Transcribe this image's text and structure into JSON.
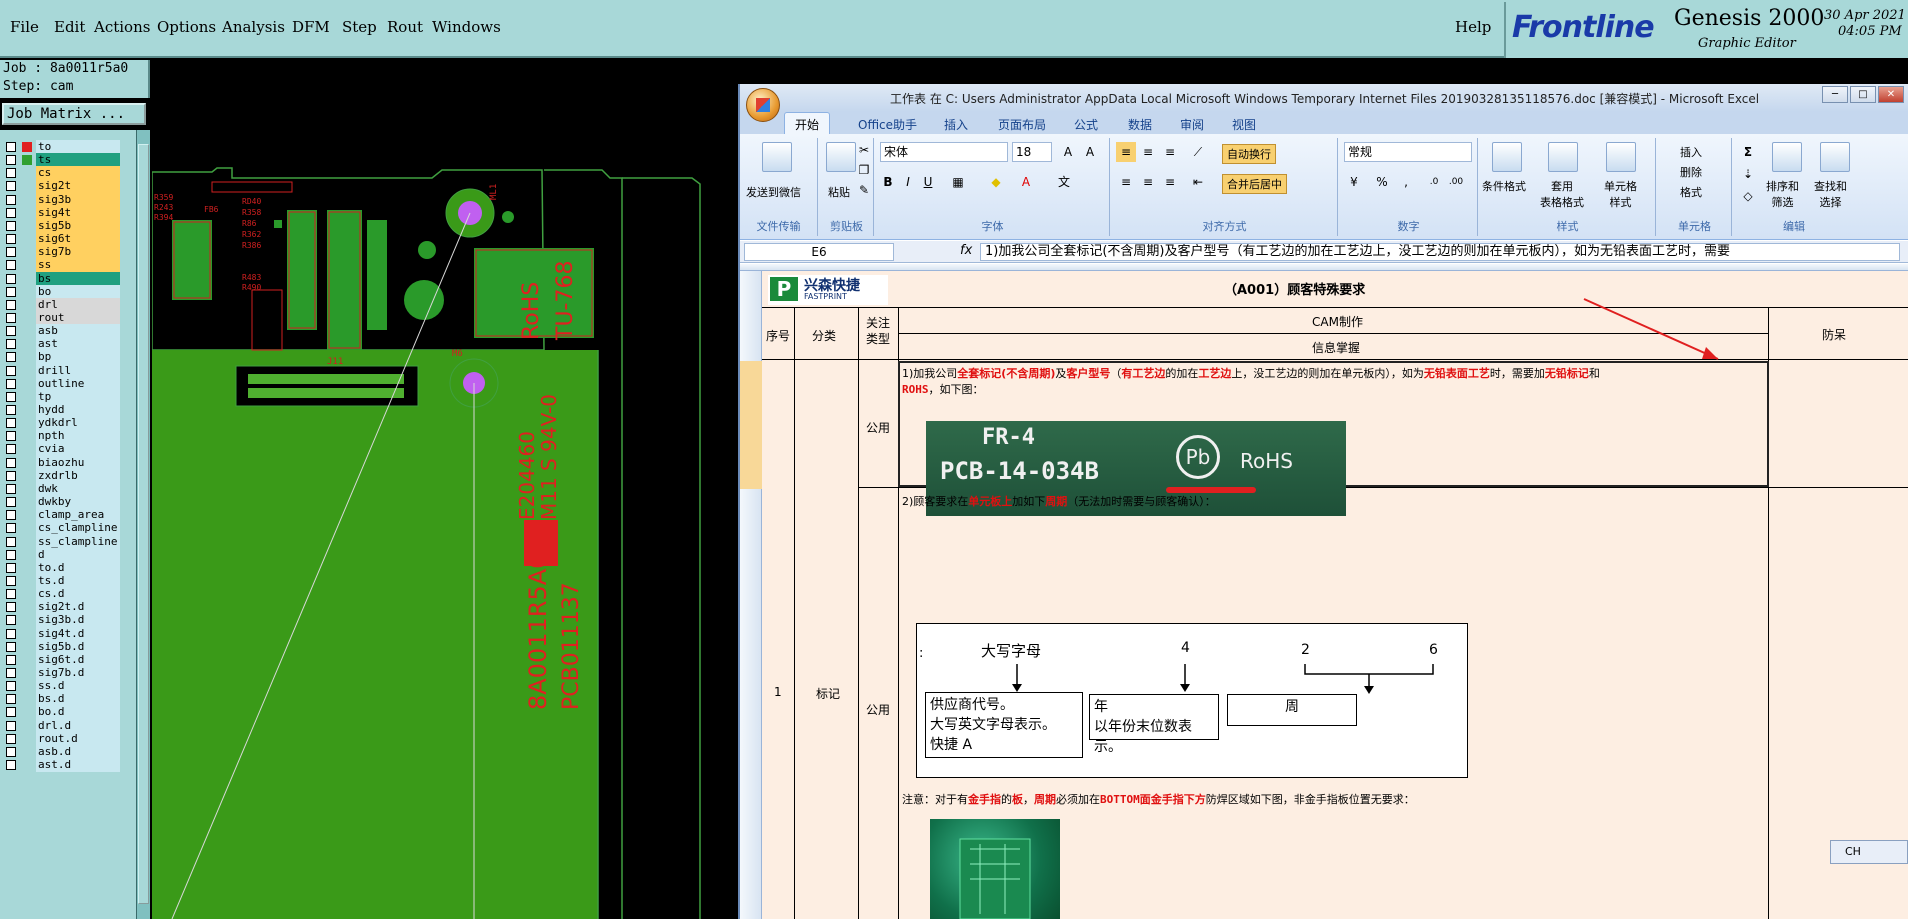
{
  "menubar": {
    "items": [
      "File",
      "Edit",
      "Actions",
      "Options",
      "Analysis",
      "DFM",
      "Step",
      "Rout",
      "Windows"
    ],
    "help": "Help"
  },
  "brand": {
    "logo": "Frontline",
    "product": "Genesis 2000",
    "subtitle": "Graphic Editor",
    "date": "30 Apr 2021",
    "time": "04:05 PM"
  },
  "job": {
    "job_line": "Job : 8a0011r5a0",
    "step_line": "Step: cam",
    "matrix_button": "Job Matrix ..."
  },
  "layers": [
    {
      "name": "to",
      "type": "misc"
    },
    {
      "name": "ts",
      "type": "sel"
    },
    {
      "name": "cs",
      "type": "board"
    },
    {
      "name": "sig2t",
      "type": "board"
    },
    {
      "name": "sig3b",
      "type": "board"
    },
    {
      "name": "sig4t",
      "type": "board"
    },
    {
      "name": "sig5b",
      "type": "board"
    },
    {
      "name": "sig6t",
      "type": "board"
    },
    {
      "name": "sig7b",
      "type": "board"
    },
    {
      "name": "ss",
      "type": "board"
    },
    {
      "name": "bs",
      "type": "sel"
    },
    {
      "name": "bo",
      "type": "misc"
    },
    {
      "name": "drl",
      "type": "gray"
    },
    {
      "name": "rout",
      "type": "gray"
    },
    {
      "name": "asb",
      "type": "misc"
    },
    {
      "name": "ast",
      "type": "misc"
    },
    {
      "name": "bp",
      "type": "misc"
    },
    {
      "name": "drill",
      "type": "misc"
    },
    {
      "name": "outline",
      "type": "misc"
    },
    {
      "name": "tp",
      "type": "misc"
    },
    {
      "name": "hydd",
      "type": "misc"
    },
    {
      "name": "ydkdrl",
      "type": "misc"
    },
    {
      "name": "npth",
      "type": "misc"
    },
    {
      "name": "cvia",
      "type": "misc"
    },
    {
      "name": "biaozhu",
      "type": "misc"
    },
    {
      "name": "zxdrlb",
      "type": "misc"
    },
    {
      "name": "dwk",
      "type": "misc"
    },
    {
      "name": "dwkby",
      "type": "misc"
    },
    {
      "name": "clamp_area",
      "type": "misc"
    },
    {
      "name": "cs_clampline",
      "type": "misc"
    },
    {
      "name": "ss_clampline",
      "type": "misc"
    },
    {
      "name": "d",
      "type": "misc"
    },
    {
      "name": "to.d",
      "type": "misc"
    },
    {
      "name": "ts.d",
      "type": "misc"
    },
    {
      "name": "cs.d",
      "type": "misc"
    },
    {
      "name": "sig2t.d",
      "type": "misc"
    },
    {
      "name": "sig3b.d",
      "type": "misc"
    },
    {
      "name": "sig4t.d",
      "type": "misc"
    },
    {
      "name": "sig5b.d",
      "type": "misc"
    },
    {
      "name": "sig6t.d",
      "type": "misc"
    },
    {
      "name": "sig7b.d",
      "type": "misc"
    },
    {
      "name": "ss.d",
      "type": "misc"
    },
    {
      "name": "bs.d",
      "type": "misc"
    },
    {
      "name": "bo.d",
      "type": "misc"
    },
    {
      "name": "drl.d",
      "type": "misc"
    },
    {
      "name": "rout.d",
      "type": "misc"
    },
    {
      "name": "asb.d",
      "type": "misc"
    },
    {
      "name": "ast.d",
      "type": "misc"
    }
  ],
  "pcb": {
    "texts": [
      "RoHS",
      "TU-768",
      "E204460",
      "M11 S 94V-0",
      "8A0011R5A0",
      "PCB011137",
      "J11",
      "ML1",
      "M6"
    ]
  },
  "excel": {
    "title": "工作表 在 C: Users Administrator AppData Local Microsoft Windows Temporary Internet Files 20190328135118576.doc [兼容模式] - Microsoft Excel",
    "tabs": [
      "开始",
      "Office助手",
      "插入",
      "页面布局",
      "公式",
      "数据",
      "审阅",
      "视图"
    ],
    "ribbon": {
      "send_wechat": "发送到微信",
      "file_transfer": "文件传输",
      "paste": "粘贴",
      "clipboard": "剪贴板",
      "font_name": "宋体",
      "font_size": "18",
      "font_group": "字体",
      "wrap": "自动换行",
      "merge": "合并后居中",
      "align_group": "对齐方式",
      "number_format": "常规",
      "number_group": "数字",
      "cond_format": "条件格式",
      "table_format": "套用\n表格格式",
      "cell_style": "单元格\n样式",
      "style_group": "样式",
      "insert": "插入",
      "delete": "删除",
      "format": "格式",
      "cells_group": "单元格",
      "sort": "排序和\n筛选",
      "find": "查找和\n选择",
      "edit_group": "编辑"
    },
    "namebox": "E6",
    "formula": "1)加我公司全套标记(不含周期)及客户型号（有工艺边的加在工艺边上，没工艺边的则加在单元板内），如为无铅表面工艺时，需要",
    "sheet": {
      "logo_cn": "兴森快捷",
      "logo_en": "FASTPRINT",
      "header_title": "（A001）顾客特殊要求",
      "col_seq": "序号",
      "col_category": "分类",
      "col_focus": "关注\n类型",
      "col_cam": "CAM制作",
      "col_info": "信息掌握",
      "col_prevent": "防呆",
      "row_seq": "1",
      "row_category": "标记",
      "focus1": "公用",
      "focus2": "公用",
      "req1_line1_parts": [
        "1)加我公司",
        "全套标记(不含周期)",
        "及",
        "客户型号",
        "（",
        "有工艺边",
        "的加在",
        "工艺边",
        "上，没工艺边的则加在单元板内），如为",
        "无铅表面工艺",
        "时，需要加",
        "无铅标记",
        "和"
      ],
      "req1_line2_parts": [
        "ROHS",
        "，如下图："
      ],
      "photo1_line1": "FR-4",
      "photo1_line2": "PCB-14-034B",
      "photo1_pb": "Pb",
      "photo1_rohs": "RoHS",
      "req2_parts": [
        "2)顾客要求在",
        "单元板上",
        "加如下",
        "周期",
        "（无法加时需要与顾客确认）："
      ],
      "diagram": {
        "colon": ":",
        "top1": "大写字母",
        "top2": "4",
        "top3": "2",
        "top4": "6",
        "box1": [
          "供应商代号。",
          "大写英文字母表示。",
          "快捷 A"
        ],
        "box2": [
          "年",
          "以年份末位数表示。"
        ],
        "box3": "周"
      },
      "note_parts": [
        "注意：对于有",
        "金手指",
        "的",
        "板",
        "，",
        "周期",
        "必须加在",
        "BOTTOM面金手指下方",
        "防焊区域如下图，非金手指板位置无要求："
      ]
    }
  },
  "ime": "CH"
}
